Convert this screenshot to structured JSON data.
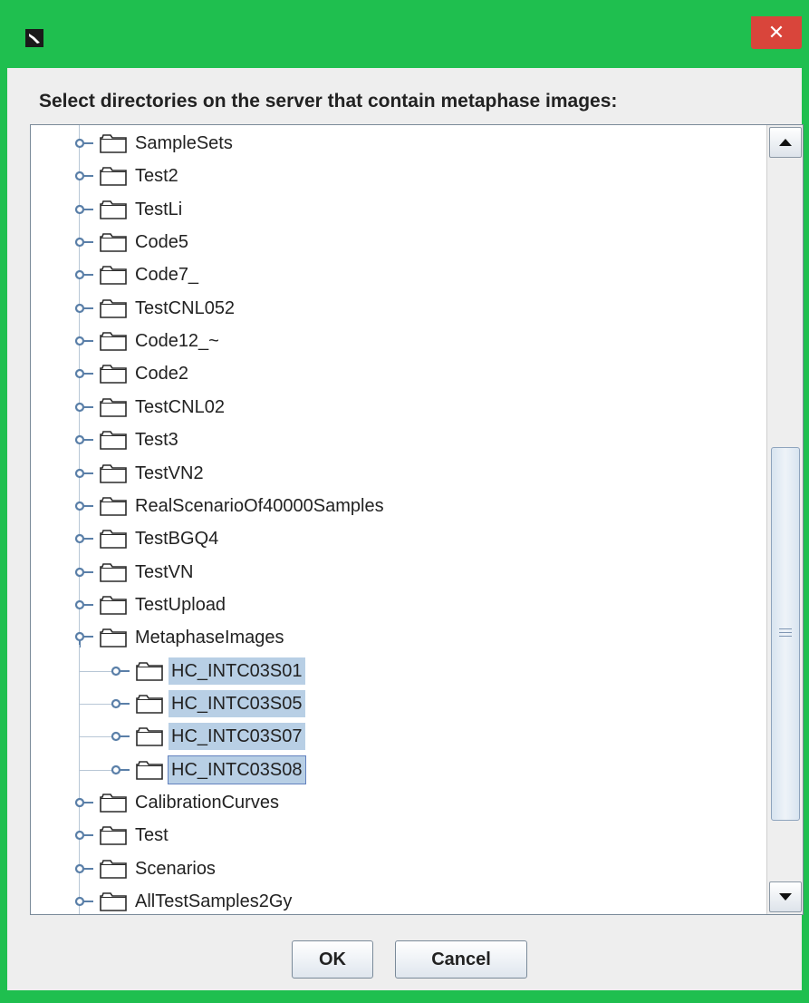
{
  "window": {
    "close_glyph": "✕",
    "prompt": "Select directories on the server that contain metaphase images:"
  },
  "tree": {
    "top_items": [
      "SampleSets",
      "Test2",
      "TestLi",
      "Code5",
      "Code7_",
      "TestCNL052",
      "Code12_~",
      "Code2",
      "TestCNL02",
      "Test3",
      "TestVN2",
      "RealScenarioOf40000Samples",
      "TestBGQ4",
      "TestVN",
      "TestUpload"
    ],
    "expanded_item": "MetaphaseImages",
    "children": [
      {
        "label": "HC_INTC03S01",
        "selected": true
      },
      {
        "label": "HC_INTC03S05",
        "selected": true
      },
      {
        "label": "HC_INTC03S07",
        "selected": true
      },
      {
        "label": "HC_INTC03S08",
        "selected": true,
        "focused": true
      }
    ],
    "bottom_items": [
      "CalibrationCurves",
      "Test",
      "Scenarios",
      "AllTestSamples2Gy"
    ]
  },
  "buttons": {
    "ok": "OK",
    "cancel": "Cancel"
  },
  "colors": {
    "title_bar": "#1fbf4f",
    "close_button": "#d9453b",
    "selection": "#b8cfe5"
  },
  "icons": {
    "app": "app-icon",
    "close": "close-icon",
    "folder": "folder-icon",
    "collapsed_handle": "collapsed-handle-icon",
    "expanded_handle": "expanded-handle-icon",
    "scroll_up": "scroll-up-arrow-icon",
    "scroll_down": "scroll-down-arrow-icon"
  }
}
